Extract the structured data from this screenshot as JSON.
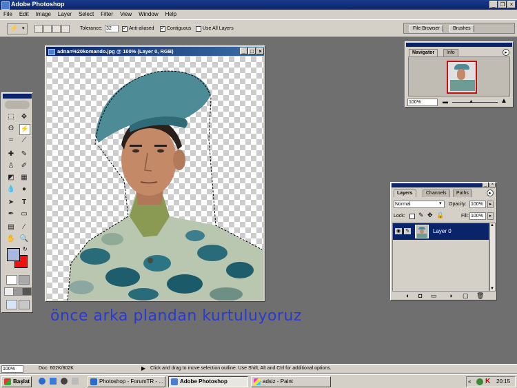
{
  "window": {
    "title": "Adobe Photoshop"
  },
  "menu": [
    "File",
    "Edit",
    "Image",
    "Layer",
    "Select",
    "Filter",
    "View",
    "Window",
    "Help"
  ],
  "options": {
    "tolerance_label": "Tolerance:",
    "tolerance_value": "32",
    "anti_aliased": "Anti-aliased",
    "contiguous": "Contiguous",
    "use_all_layers": "Use All Layers"
  },
  "palette_well": {
    "file_browser": "File Browser",
    "brushes": "Brushes"
  },
  "document": {
    "title": "adnan%20komando.jpg @ 100% (Layer 0, RGB)"
  },
  "navigator": {
    "tab_navigator": "Navigator",
    "tab_info": "Info",
    "zoom": "100%"
  },
  "layers": {
    "tab_layers": "Layers",
    "tab_channels": "Channels",
    "tab_paths": "Paths",
    "blend_mode": "Normal",
    "opacity_label": "Opacity:",
    "opacity_value": "100%",
    "lock_label": "Lock:",
    "fill_label": "Fill:",
    "fill_value": "100%",
    "layer_name": "Layer 0"
  },
  "caption": "önce arka plandan kurtuluyoruz",
  "status": {
    "zoom": "100%",
    "doc_size": "Doc: 602K/802K",
    "hint": "Click and drag to move selection outline.  Use Shift, Alt and Ctrl for additional options."
  },
  "taskbar": {
    "start": "Başlat",
    "tasks": [
      "Photoshop - ForumTR - ...",
      "Adobe Photoshop",
      "adsiz - Paint"
    ],
    "clock": "20:15"
  },
  "colors": {
    "foreground": "#a8b8e0",
    "background": "#ee1111",
    "caption": "#2a3ad0"
  }
}
